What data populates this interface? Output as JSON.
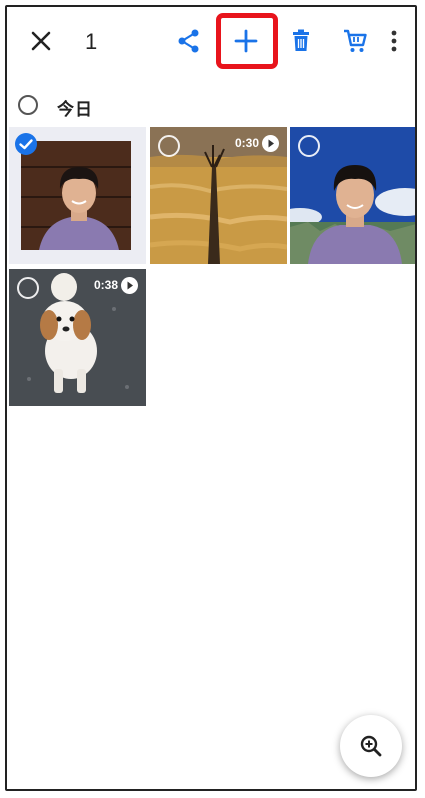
{
  "toolbar": {
    "selected_count": "1",
    "close_icon": "close-icon",
    "share_icon": "share-icon",
    "add_icon": "add-icon",
    "delete_icon": "delete-icon",
    "shop_icon": "shopping-cart-icon",
    "more_icon": "more-vert-icon",
    "accent_color": "#1a73e8",
    "highlight_color": "#e8141c"
  },
  "section": {
    "date_label": "今日"
  },
  "media": [
    {
      "kind": "photo",
      "subject": "portrait-indoor",
      "selected": true
    },
    {
      "kind": "video",
      "subject": "dry-grass-field",
      "duration": "0:30",
      "selected": false
    },
    {
      "kind": "photo",
      "subject": "portrait-sky",
      "selected": false
    },
    {
      "kind": "video",
      "subject": "dog",
      "duration": "0:38",
      "selected": false
    }
  ],
  "fab": {
    "icon": "zoom-in-icon"
  }
}
